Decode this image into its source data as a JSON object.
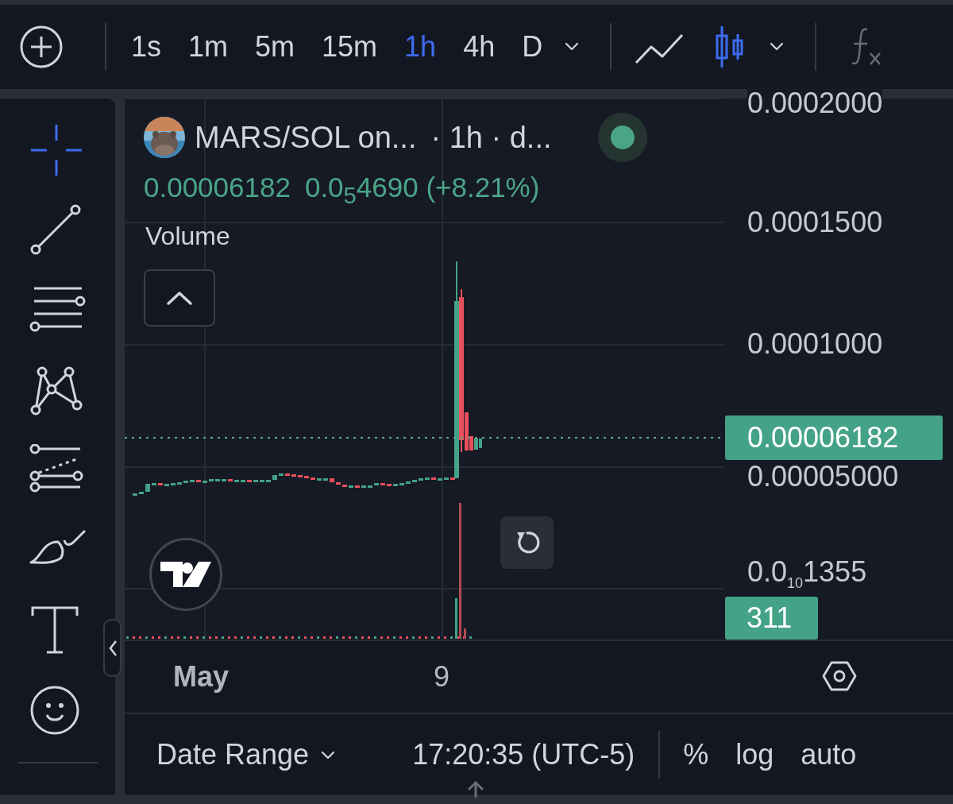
{
  "toolbar": {
    "timeframes": [
      {
        "label": "1s",
        "selected": false
      },
      {
        "label": "1m",
        "selected": false
      },
      {
        "label": "5m",
        "selected": false
      },
      {
        "label": "15m",
        "selected": false
      },
      {
        "label": "1h",
        "selected": true
      },
      {
        "label": "4h",
        "selected": false
      },
      {
        "label": "D",
        "selected": false
      }
    ],
    "chart_types": [
      {
        "kind": "line",
        "selected": false
      },
      {
        "kind": "candles",
        "selected": true
      }
    ],
    "indicators_disabled": true
  },
  "drawing_tools": [
    {
      "kind": "crosshair",
      "selected": true
    },
    {
      "kind": "trend-line",
      "selected": false
    },
    {
      "kind": "fib",
      "selected": false
    },
    {
      "kind": "pattern",
      "selected": false
    },
    {
      "kind": "projection",
      "selected": false
    },
    {
      "kind": "brush",
      "selected": false
    },
    {
      "kind": "text",
      "selected": false
    },
    {
      "kind": "emoji",
      "selected": false
    }
  ],
  "legend": {
    "symbol": "MARS/SOL on...",
    "details": "· 1h · d...",
    "market_open": true,
    "price": "0.00006182",
    "change": "0.0$_{5}$4690 (+8.21%)",
    "volume_label": "Volume"
  },
  "price_axis": {
    "labels": [
      "0.0002000",
      "0.0001500",
      "0.0001000",
      "0.00005000",
      "0.0$_{10}$1355"
    ],
    "price_tag": "0.00006182",
    "volume_tag": "311"
  },
  "time_axis": {
    "labels": [
      {
        "text": "May",
        "bold": true
      },
      {
        "text": "9",
        "bold": false
      }
    ]
  },
  "bottom_bar": {
    "date_range": "Date Range",
    "time": "17:20:35 (UTC-5)",
    "options": [
      "%",
      "log",
      "auto"
    ]
  }
}
